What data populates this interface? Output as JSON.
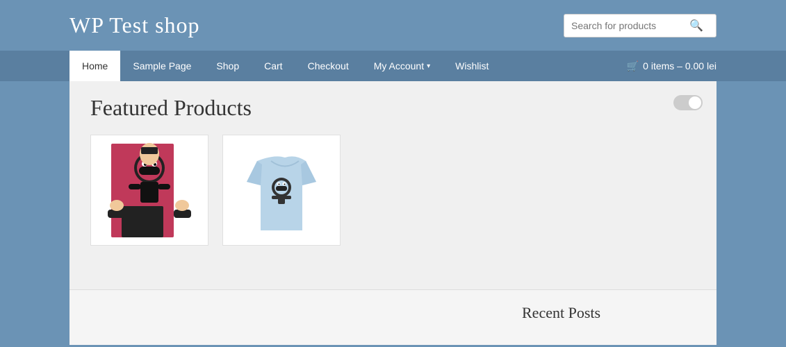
{
  "site": {
    "title": "WP Test shop"
  },
  "search": {
    "placeholder": "Search for products",
    "icon": "🔍"
  },
  "nav": {
    "items": [
      {
        "label": "Home",
        "active": true
      },
      {
        "label": "Sample Page",
        "active": false
      },
      {
        "label": "Shop",
        "active": false
      },
      {
        "label": "Cart",
        "active": false
      },
      {
        "label": "Checkout",
        "active": false
      },
      {
        "label": "My Account",
        "active": false,
        "has_arrow": true
      },
      {
        "label": "Wishlist",
        "active": false
      }
    ],
    "cart": {
      "icon": "🛒",
      "label": "0 items – 0.00 lei"
    }
  },
  "featured": {
    "title": "Featured Products",
    "products": [
      {
        "id": 1,
        "type": "ninja-poster",
        "alt": "Ninja poster product"
      },
      {
        "id": 2,
        "type": "tshirt",
        "alt": "T-shirt product"
      }
    ]
  },
  "sidebar": {
    "recent_posts_title": "Recent Posts"
  }
}
